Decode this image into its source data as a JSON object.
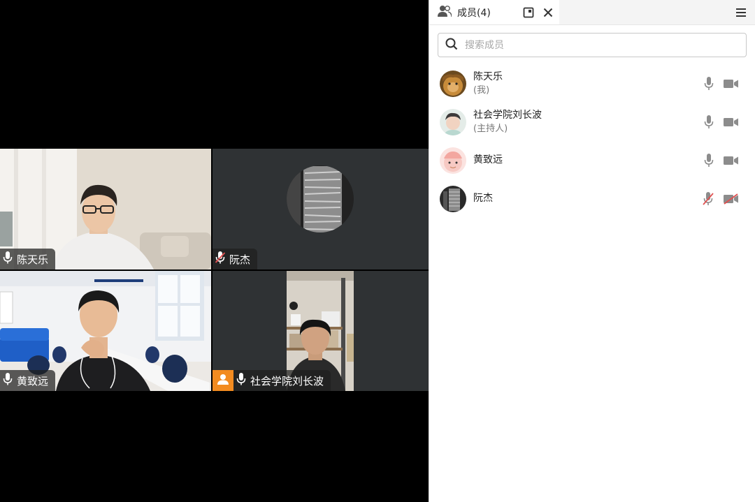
{
  "tiles": [
    {
      "name": "陈天乐",
      "mic": "on"
    },
    {
      "name": "阮杰",
      "mic": "off"
    },
    {
      "name": "黄致远",
      "mic": "on"
    },
    {
      "name": "社会学院刘长波",
      "mic": "on",
      "host": true
    }
  ],
  "panel": {
    "tab_title": "成员(4)",
    "search_placeholder": "搜索成员",
    "members": [
      {
        "name": "陈天乐",
        "role": "(我)",
        "mic": "on",
        "camera": "on"
      },
      {
        "name": "社会学院刘长波",
        "role": "(主持人)",
        "mic": "on",
        "camera": "on"
      },
      {
        "name": "黄致远",
        "role": "",
        "mic": "on",
        "camera": "on"
      },
      {
        "name": "阮杰",
        "role": "",
        "mic": "off",
        "camera": "off"
      }
    ]
  },
  "colors": {
    "host_badge": "#f28b20",
    "muted_red": "#e05050",
    "icon_gray": "#8c8c8c"
  }
}
